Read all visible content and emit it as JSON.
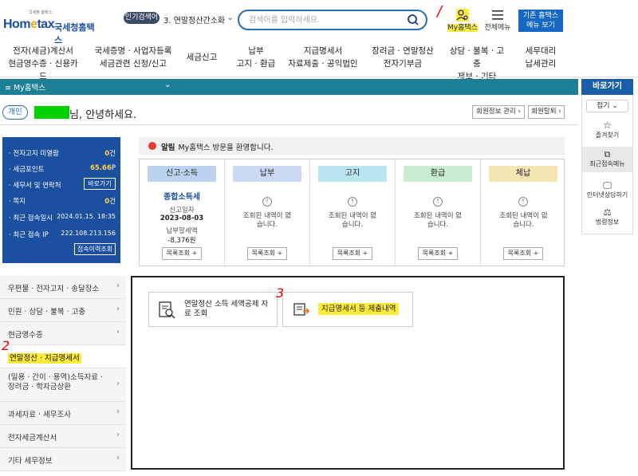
{
  "header": {
    "logo_tiny": "국세청 홈택스",
    "logo_main_a": "Hom",
    "logo_main_e": "e",
    "logo_main_b": "tax",
    "logo_sub": "국세청홈택스",
    "popular_badge": "인기검색어",
    "popular_term": "3. 연말정산간소화",
    "search_placeholder": "검색어를 입력하세요.",
    "my_hometax": "My홈택스",
    "all_menu": "전체메뉴",
    "old_hometax_line1": "기존 홈택스",
    "old_hometax_line2": "메뉴 보기"
  },
  "nav": [
    {
      "l1": "전자(세금)계산서",
      "l2": "현금영수증 · 신용카드"
    },
    {
      "l1": "국세증명 · 사업자등록",
      "l2": "세금관련 신청/신고"
    },
    {
      "l1": "세금신고",
      "l2": ""
    },
    {
      "l1": "납부",
      "l2": "고지 · 환급"
    },
    {
      "l1": "지급명세서",
      "l2": "자료제출 · 공익법인"
    },
    {
      "l1": "장려금 · 연말정산",
      "l2": "전자기부금"
    },
    {
      "l1": "상담 · 불복 · 고충",
      "l2": "제보 · 기타"
    },
    {
      "l1": "세무대리",
      "l2": "납세관리"
    }
  ],
  "mybar": {
    "title": "My홈택스",
    "chevron": "⌄"
  },
  "quick": {
    "title": "바로가기",
    "fold": "접기 ⌄",
    "items": [
      "즐겨찾기",
      "최근접속메뉴",
      "인터넷상담하기",
      "법령정보"
    ]
  },
  "greeting": {
    "tag": "개인",
    "text": "님, 안녕하세요.",
    "manage_btn": "회원정보 관리 ›",
    "withdraw_btn": "회원탈퇴 ›"
  },
  "info": {
    "rows": [
      {
        "label": "전자고지 미열람",
        "value": "0",
        "unit": "건"
      },
      {
        "label": "세금포인트",
        "value": "65.66",
        "unit": "P"
      },
      {
        "label": "세무서 및 연락처",
        "button": "바로가기"
      },
      {
        "label": "쪽지",
        "value": "0",
        "unit": "건"
      },
      {
        "label": "최근 접속일시",
        "plain": "2024.01.15.  18:35"
      },
      {
        "label": "최근 접속 IP",
        "plain": "222.108.213.156"
      }
    ],
    "history_btn": "접속이력조회"
  },
  "alert": {
    "title": "알림",
    "text": "My홈택스 방문을 환영합니다."
  },
  "cards": [
    {
      "title": "신고·소득",
      "color": "#bcd3f0",
      "kind": "detail",
      "link": "종합소득세",
      "date_label": "신고일자",
      "date": "2023-08-03",
      "amount_label": "납부할세액",
      "amount": "-8,376원",
      "btn": "목록조회 +"
    },
    {
      "title": "납부",
      "color": "#cbd9f3",
      "kind": "none",
      "none_text": "조회된 내역이 없습니다.",
      "btn": "목록조회 +"
    },
    {
      "title": "고지",
      "color": "#b9e6ee",
      "kind": "none",
      "none_text": "조회된 내역이 없습니다.",
      "btn": "목록조회 +"
    },
    {
      "title": "환급",
      "color": "#c9ecd0",
      "kind": "none",
      "none_text": "조회된 내역이 없습니다.",
      "btn": "목록조회 +"
    },
    {
      "title": "체납",
      "color": "#f3e6b3",
      "kind": "none",
      "none_text": "조회된 내역이 없습니다.",
      "btn": "목록조회 +"
    }
  ],
  "left_menu": [
    "우편물 · 전자고지 · 송달장소",
    "민원 · 상담 · 불복 · 고충",
    "현금영수증",
    "연말정산 · 지급명세서",
    "(일용 · 간이 · 용역)소득자료 · 장려금 · 학자금상환",
    "과세자료 · 세무조사",
    "전자세금계산서",
    "기타 세무정보"
  ],
  "panel": {
    "card1": "연말정산 소득 세액공제 자료 조회",
    "card2": "지급명세서 등 제출내역"
  },
  "annotations": {
    "n1": "/",
    "n2": "2",
    "n3": "3"
  },
  "colors": {
    "brand_blue": "#1b4fa0",
    "teal": "#1b7f96",
    "highlight": "#ffeb3b",
    "mask_green": "#00d200",
    "annotation_red": "#ee0000"
  }
}
